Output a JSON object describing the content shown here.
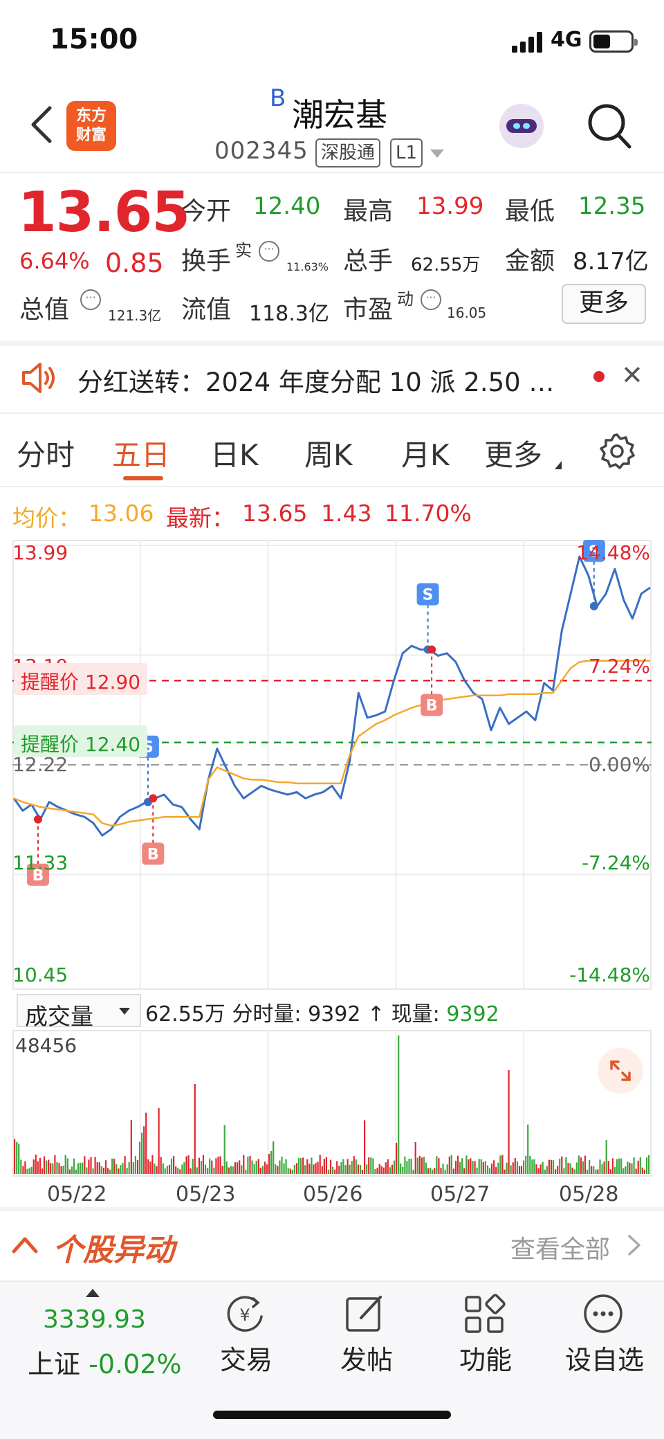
{
  "status_bar": {
    "time": "15:00",
    "network": "4G"
  },
  "header": {
    "logo_line1": "东方",
    "logo_line2": "财富",
    "b_mark": "B",
    "stock_name": "潮宏基",
    "stock_code": "002345",
    "tag_exchange": "深股通",
    "tag_level": "L1"
  },
  "quote": {
    "price": "13.65",
    "change_pct": "6.64%",
    "change_val": "0.85",
    "open_label": "今开",
    "open": "12.40",
    "high_label": "最高",
    "high": "13.99",
    "low_label": "最低",
    "low": "12.35",
    "turnover_label": "换手",
    "turnover_sup": "实",
    "turnover": "11.63%",
    "volume_label": "总手",
    "volume": "62.55万",
    "amount_label": "金额",
    "amount": "8.17亿",
    "mktcap_label": "总值",
    "mktcap": "121.3亿",
    "float_label": "流值",
    "float": "118.3亿",
    "pe_label": "市盈",
    "pe_sup": "动",
    "pe": "16.05",
    "info_glyph": "···",
    "more_button": "更多"
  },
  "notice": {
    "text": "分红送转：2024 年度分配 10 派 2.50 …",
    "close": "✕"
  },
  "tabs": [
    "分时",
    "五日",
    "日K",
    "周K",
    "月K",
    "更多"
  ],
  "active_tab": "五日",
  "legend": {
    "avg_label": "均价：",
    "avg_value": "13.06",
    "latest_label": "最新：",
    "latest_value": "13.65",
    "latest_change": "1.43",
    "latest_pct": "11.70%"
  },
  "chart_data": {
    "type": "line",
    "x": [
      "05/22",
      "05/23",
      "05/26",
      "05/27",
      "05/28"
    ],
    "y_axis_left": [
      "13.99",
      "13.10",
      "12.22",
      "11.33",
      "10.45"
    ],
    "y_axis_right": [
      "14.48%",
      "7.24%",
      "0.00%",
      "-7.24%",
      "-14.48%"
    ],
    "ylim": [
      10.45,
      13.99
    ],
    "reference_price": 12.22,
    "series": [
      {
        "name": "最新",
        "color": "#3a6fc4",
        "values": [
          11.95,
          11.85,
          11.9,
          11.78,
          11.92,
          11.88,
          11.85,
          11.82,
          11.8,
          11.75,
          11.65,
          11.7,
          11.8,
          11.85,
          11.88,
          11.92,
          11.95,
          11.98,
          11.9,
          11.88,
          11.78,
          11.7,
          12.1,
          12.35,
          12.2,
          12.05,
          11.95,
          12.0,
          12.05,
          12.02,
          12.0,
          11.98,
          12.0,
          11.95,
          11.98,
          12.0,
          12.05,
          11.95,
          12.25,
          12.8,
          12.6,
          12.62,
          12.65,
          12.9,
          13.12,
          13.18,
          13.15,
          13.15,
          13.1,
          13.12,
          13.05,
          12.9,
          12.8,
          12.75,
          12.5,
          12.68,
          12.55,
          12.6,
          12.65,
          12.58,
          12.88,
          12.82,
          13.3,
          13.6,
          13.9,
          13.75,
          13.5,
          13.6,
          13.8,
          13.55,
          13.4,
          13.6,
          13.65
        ]
      },
      {
        "name": "均价",
        "color": "#f3a92b",
        "values": [
          11.95,
          11.92,
          11.9,
          11.88,
          11.87,
          11.86,
          11.85,
          11.84,
          11.83,
          11.82,
          11.75,
          11.73,
          11.74,
          11.76,
          11.77,
          11.78,
          11.79,
          11.8,
          11.8,
          11.8,
          11.8,
          11.8,
          12.1,
          12.2,
          12.17,
          12.14,
          12.11,
          12.1,
          12.1,
          12.09,
          12.08,
          12.08,
          12.07,
          12.07,
          12.07,
          12.07,
          12.07,
          12.07,
          12.3,
          12.45,
          12.5,
          12.55,
          12.58,
          12.62,
          12.65,
          12.68,
          12.7,
          12.72,
          12.74,
          12.75,
          12.76,
          12.77,
          12.78,
          12.78,
          12.78,
          12.78,
          12.79,
          12.79,
          12.79,
          12.79,
          12.8,
          12.8,
          12.9,
          13.0,
          13.05,
          13.06,
          13.06,
          13.06,
          13.06,
          13.06,
          13.06,
          13.06,
          13.06
        ]
      }
    ],
    "alerts": [
      {
        "label": "提醒价 12.90",
        "value": 12.9,
        "color": "#e0262d"
      },
      {
        "label": "提醒价 12.40",
        "value": 12.4,
        "color": "#1f9b2b"
      }
    ],
    "trade_markers": [
      {
        "type": "B",
        "day": 1,
        "at": 0.2
      },
      {
        "type": "S",
        "day": 2,
        "at": 0.06
      },
      {
        "type": "B",
        "day": 2,
        "at": 0.1
      },
      {
        "type": "S",
        "day": 4,
        "at": 0.25
      },
      {
        "type": "B",
        "day": 4,
        "at": 0.28
      },
      {
        "type": "S",
        "day": 5,
        "at": 0.55
      }
    ]
  },
  "volume": {
    "selector": "成交量",
    "total": "62.55万",
    "tick_label": "分时量:",
    "tick_value": "9392",
    "arrow": "↑",
    "now_label": "现量:",
    "now_value": "9392",
    "max_label": "48456"
  },
  "dates": [
    "05/22",
    "05/23",
    "05/26",
    "05/27",
    "05/28"
  ],
  "anomaly": {
    "title": "个股异动",
    "view_all": "查看全部"
  },
  "bottom_nav": {
    "index_value": "3339.93",
    "index_name": "上证",
    "index_change": "-0.02%",
    "items": [
      "交易",
      "发帖",
      "功能",
      "设自选"
    ]
  }
}
